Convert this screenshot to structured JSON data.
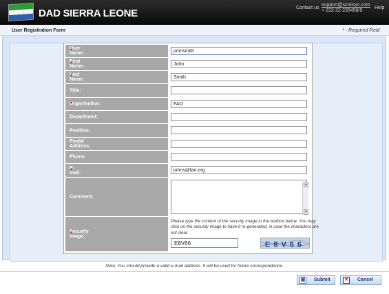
{
  "header": {
    "brand": "DAD SIERRA LEONE",
    "contact_label": "Contact us",
    "contact_email": "support@ssmisys.com",
    "contact_phone": "+ 232-22-235458/9",
    "help": "Help"
  },
  "form": {
    "title": "User Registration Form",
    "required_note": "* - Required Field",
    "fields": [
      {
        "label": "User Name:",
        "required": "*",
        "value": "johnsmith"
      },
      {
        "label": "First Name:",
        "required": "*",
        "value": "John"
      },
      {
        "label": "Last Name:",
        "required": "*",
        "value": "Smith"
      },
      {
        "label": "Title:",
        "required": "",
        "value": ""
      },
      {
        "label": "Organisation:",
        "required": "*",
        "value": "FAO"
      },
      {
        "label": "Department:",
        "required": "",
        "value": ""
      },
      {
        "label": "Position:",
        "required": "",
        "value": ""
      },
      {
        "label": "Postal Address:",
        "required": "",
        "value": ""
      },
      {
        "label": "Phone:",
        "required": "",
        "value": ""
      },
      {
        "label": "E-mail:",
        "required": "*",
        "value": "johns@fao.org"
      }
    ],
    "comment": {
      "label": "Comment:",
      "value": ""
    },
    "security": {
      "label": "Security Image:",
      "required": "*",
      "instructions": "Please type the content of the security image in the textbox below. You may click on the security image to have it re-generated, in case the characters are not clear.",
      "value": "E8V66",
      "image_text": "E8V66"
    }
  },
  "note": "Note: You should provide a valid e-mail address. It will be used for future correspondence.",
  "buttons": {
    "submit": "Submit",
    "cancel": "Cancel"
  },
  "colors": {
    "header_bg": "#0a0a0a",
    "label_bg": "#a8a8a8",
    "panel_bg": "#dbe7f6",
    "required_star": "#c00000"
  }
}
